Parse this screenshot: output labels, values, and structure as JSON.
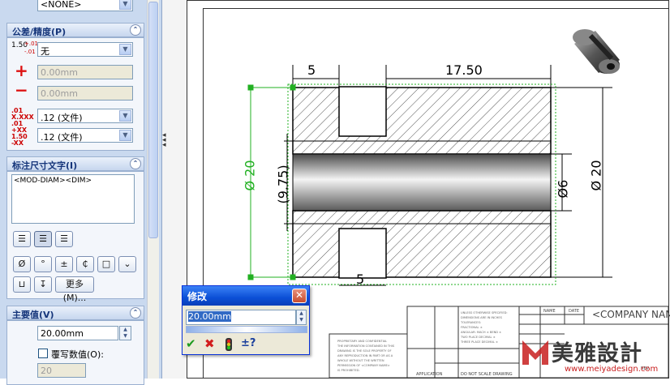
{
  "left_panel": {
    "top_dropdown": "<NONE>",
    "tolerance": {
      "title": "公差/精度(P)",
      "tolerance_type": "无",
      "plus_value": "0.00mm",
      "minus_value": "0.00mm",
      "primary_precision": ".12 (文件)",
      "tolerance_precision": ".12 (文件)",
      "icon_text_a": "1.50",
      "icon_text_b": "+.01",
      "icon_text_c": "-.01"
    },
    "dim_text": {
      "title": "标注尺寸文字(I)",
      "content": "<MOD-DIAM><DIM>",
      "more_button": "更多(M)..."
    },
    "primary_value": {
      "title": "主要值(V)",
      "value": "20.00mm",
      "override_label": "覆写数值(O):",
      "override_value": "20"
    }
  },
  "modify_dialog": {
    "title": "修改",
    "value": "20.00mm"
  },
  "drawing": {
    "dims": {
      "top_left": "5",
      "top_right": "17.50",
      "bottom": "5",
      "left_diameter": "Ø 20",
      "left_ref": "(9.75)",
      "right_diameter_small": "Ø6",
      "right_diameter_large": "Ø 20"
    },
    "title_block": {
      "company": "<COMPANY NAM",
      "application": "APPLICATION",
      "do_not_scale": "DO NOT SCALE DRAWING",
      "header_name": "NAME",
      "header_date": "DATE",
      "rev": "REV"
    }
  },
  "watermark": {
    "brand": "美雅設計",
    "url": "www.meiyadesign.com"
  },
  "colors": {
    "accent_blue": "#0b4fd6",
    "dimension_green": "#22b022",
    "panel_bg": "#c9d9ef"
  }
}
